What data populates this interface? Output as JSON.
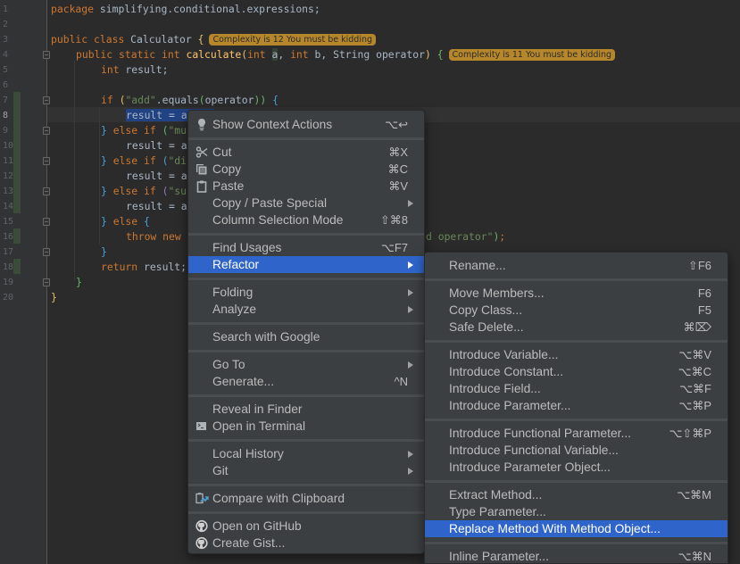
{
  "editor": {
    "line_numbers": [
      "1",
      "2",
      "3",
      "4",
      "5",
      "6",
      "7",
      "8",
      "9",
      "10",
      "11",
      "12",
      "13",
      "14",
      "15",
      "16",
      "17",
      "18",
      "19",
      "20"
    ],
    "current_line": "8",
    "lines": {
      "l1": {
        "kw": "package",
        "rest": " simplifying.conditional.expressions;"
      },
      "l3": {
        "kw1": "public",
        "kw2": "class",
        "name": " Calculator ",
        "brace": "{"
      },
      "l4": {
        "kw1": "public",
        "kw2": "static",
        "kw3": "int",
        "fn": "calculate",
        "p1": "(",
        "kw4": "int",
        "a": "a",
        "mid": ", ",
        "kw5": "int",
        "b": " b, String operator",
        "p2": ")",
        "brace": "{"
      },
      "l5": {
        "kw": "int",
        "rest": " result;"
      },
      "l7": {
        "kw": "if",
        "p1": "(",
        "str": "\"add\"",
        "mid": ".equals",
        "p2": "(",
        "arg": "operator",
        "p3": "))",
        "brace": "{"
      },
      "l8": {
        "text": "result = a"
      },
      "l9": {
        "brace": "}",
        "kw1": "else",
        "kw2": "if",
        "p": "(",
        "str": "\"mu"
      },
      "l10": {
        "text": "result = a"
      },
      "l11": {
        "brace": "}",
        "kw1": "else",
        "kw2": "if",
        "p": "(",
        "str": "\"di"
      },
      "l12": {
        "text": "result = a"
      },
      "l13": {
        "brace": "}",
        "kw1": "else",
        "kw2": "if",
        "p": "(",
        "str": "\"su"
      },
      "l14": {
        "text": "result = a"
      },
      "l15": {
        "brace1": "}",
        "kw": "else",
        "brace2": "{"
      },
      "l16": {
        "kw1": "throw",
        "kw2": "new",
        "tail_str": "d operator\"",
        "tail_p": ")",
        "tail_semi": ";"
      },
      "l17": {
        "brace": "}"
      },
      "l18": {
        "kw": "return",
        "rest": " result;"
      },
      "l19": {
        "brace": "}"
      },
      "l20": {
        "brace": "}"
      }
    },
    "hints": {
      "class_complexity": "Complexity is 12 You must be kidding",
      "method_complexity": "Complexity is 11 You must be kidding"
    }
  },
  "context_menu": {
    "items": [
      {
        "label": "Show Context Actions",
        "shortcut": "⌥↩",
        "icon": "lightbulb-icon"
      },
      {
        "label": "Cut",
        "shortcut": "⌘X",
        "icon": "scissors-icon"
      },
      {
        "label": "Copy",
        "shortcut": "⌘C",
        "icon": "copy-icon"
      },
      {
        "label": "Paste",
        "shortcut": "⌘V",
        "icon": "clipboard-icon"
      },
      {
        "label": "Copy / Paste Special",
        "submenu": true
      },
      {
        "label": "Column Selection Mode",
        "shortcut": "⇧⌘8"
      },
      {
        "label": "Find Usages",
        "shortcut": "⌥F7"
      },
      {
        "label": "Refactor",
        "submenu": true,
        "active": true
      },
      {
        "label": "Folding",
        "submenu": true
      },
      {
        "label": "Analyze",
        "submenu": true
      },
      {
        "label": "Search with Google"
      },
      {
        "label": "Go To",
        "submenu": true
      },
      {
        "label": "Generate...",
        "shortcut": "^N"
      },
      {
        "label": "Reveal in Finder"
      },
      {
        "label": "Open in Terminal",
        "icon": "terminal-icon"
      },
      {
        "label": "Local History",
        "submenu": true
      },
      {
        "label": "Git",
        "submenu": true
      },
      {
        "label": "Compare with Clipboard",
        "icon": "compare-clipboard-icon"
      },
      {
        "label": "Open on GitHub",
        "icon": "github-icon"
      },
      {
        "label": "Create Gist...",
        "icon": "github-icon"
      }
    ]
  },
  "refactor_submenu": {
    "items": [
      {
        "label": "Rename...",
        "shortcut": "⇧F6"
      },
      {
        "label": "Move Members...",
        "shortcut": "F6"
      },
      {
        "label": "Copy Class...",
        "shortcut": "F5"
      },
      {
        "label": "Safe Delete...",
        "shortcut": "⌘⌦"
      },
      {
        "label": "Introduce Variable...",
        "shortcut": "⌥⌘V"
      },
      {
        "label": "Introduce Constant...",
        "shortcut": "⌥⌘C"
      },
      {
        "label": "Introduce Field...",
        "shortcut": "⌥⌘F"
      },
      {
        "label": "Introduce Parameter...",
        "shortcut": "⌥⌘P"
      },
      {
        "label": "Introduce Functional Parameter...",
        "shortcut": "⌥⇧⌘P"
      },
      {
        "label": "Introduce Functional Variable..."
      },
      {
        "label": "Introduce Parameter Object..."
      },
      {
        "label": "Extract Method...",
        "shortcut": "⌥⌘M"
      },
      {
        "label": "Type Parameter..."
      },
      {
        "label": "Replace Method With Method Object...",
        "active": true
      },
      {
        "label": "Inline Parameter...",
        "shortcut": "⌥⌘N"
      }
    ]
  },
  "colors": {
    "accent_selection": "#2f65ca",
    "editor_bg": "#2b2b2b",
    "menu_bg": "#3c3f41",
    "hint_bg": "#b6862a"
  }
}
